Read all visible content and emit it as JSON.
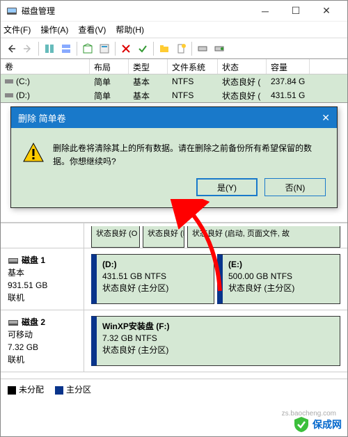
{
  "window": {
    "title": "磁盘管理"
  },
  "menu": {
    "file": "文件(F)",
    "action": "操作(A)",
    "view": "查看(V)",
    "help": "帮助(H)"
  },
  "columns": {
    "volume": "卷",
    "layout": "布局",
    "type": "类型",
    "fs": "文件系统",
    "status": "状态",
    "capacity": "容量"
  },
  "volumes": [
    {
      "name": "(C:)",
      "layout": "简单",
      "type": "基本",
      "fs": "NTFS",
      "status": "状态良好 (",
      "capacity": "237.84 G"
    },
    {
      "name": "(D:)",
      "layout": "简单",
      "type": "基本",
      "fs": "NTFS",
      "status": "状态良好 (",
      "capacity": "431.51 G"
    }
  ],
  "disk0_peek": {
    "p1": "状态良好 (O",
    "p2": "状态良好 (E",
    "p3": "状态良好 (启动, 页面文件, 故"
  },
  "disk1": {
    "header": "磁盘 1",
    "type": "基本",
    "size": "931.51 GB",
    "state": "联机",
    "parts": [
      {
        "label": "(D:)",
        "detail": "431.51 GB NTFS",
        "status": "状态良好 (主分区)"
      },
      {
        "label": "(E:)",
        "detail": "500.00 GB NTFS",
        "status": "状态良好 (主分区)"
      }
    ]
  },
  "disk2": {
    "header": "磁盘 2",
    "type": "可移动",
    "size": "7.32 GB",
    "state": "联机",
    "parts": [
      {
        "label": "WinXP安装盘  (F:)",
        "detail": "7.32 GB NTFS",
        "status": "状态良好 (主分区)"
      }
    ]
  },
  "legend": {
    "unalloc": "未分配",
    "primary": "主分区"
  },
  "dialog": {
    "title": "删除 简单卷",
    "message": "删除此卷将清除其上的所有数据。请在删除之前备份所有希望保留的数据。你想继续吗?",
    "yes": "是(Y)",
    "no": "否(N)"
  },
  "watermark": {
    "text": "保成网",
    "sub": "zs.baocheng.com"
  }
}
